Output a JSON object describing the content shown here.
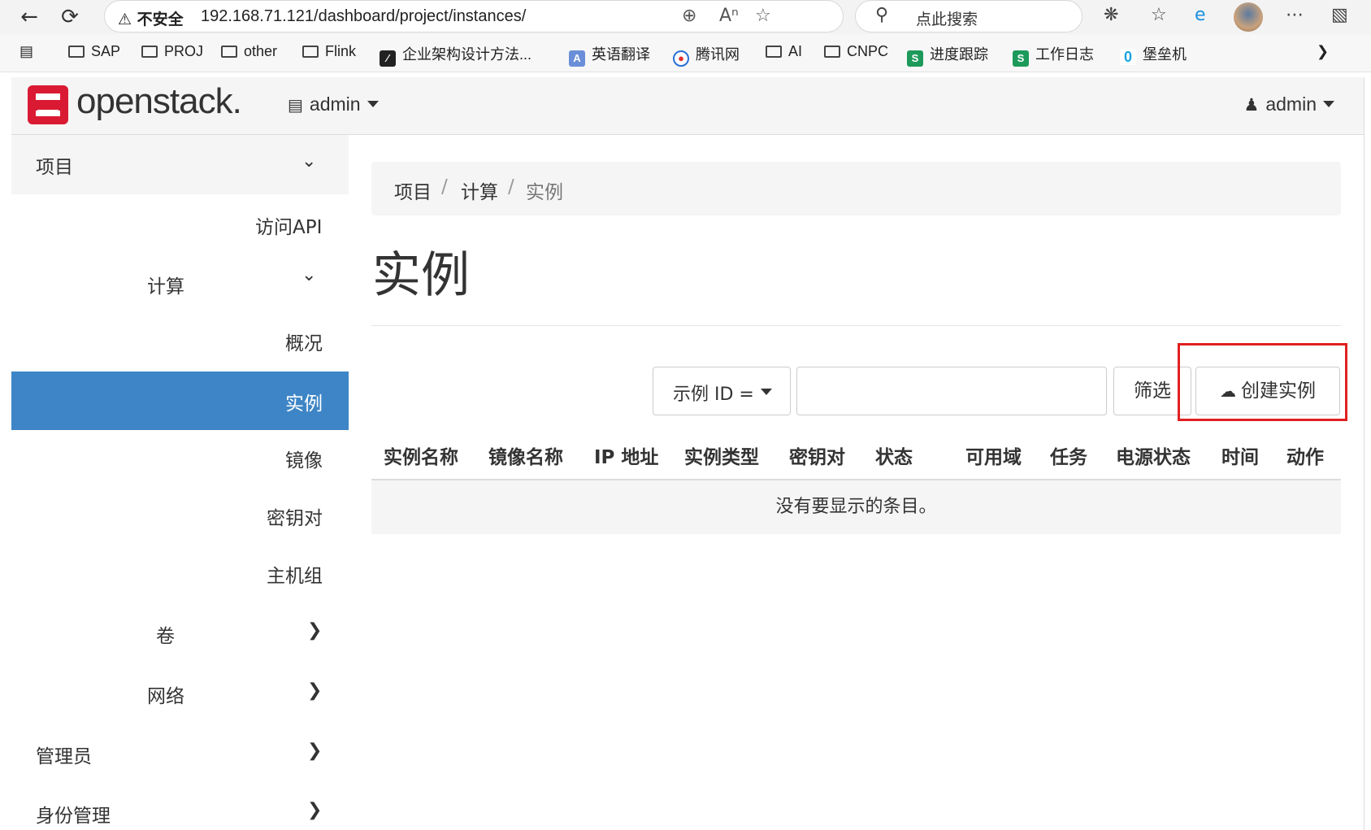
{
  "browser": {
    "security_label": "不安全",
    "url": "192.168.71.121/dashboard/project/instances/",
    "search_text": "点此搜索"
  },
  "bookmarks": [
    {
      "label": "SAP",
      "icon": "folder-icon"
    },
    {
      "label": "PROJ",
      "icon": "folder-icon"
    },
    {
      "label": "other",
      "icon": "folder-icon"
    },
    {
      "label": "Flink",
      "icon": "folder-icon"
    },
    {
      "label": "企业架构设计方法...",
      "icon": "doc-icon"
    },
    {
      "label": "英语翻译",
      "icon": "translate-icon"
    },
    {
      "label": "腾讯网",
      "icon": "tencent-icon"
    },
    {
      "label": "AI",
      "icon": "folder-icon"
    },
    {
      "label": "CNPC",
      "icon": "folder-icon"
    },
    {
      "label": "进度跟踪",
      "icon": "sheet-icon"
    },
    {
      "label": "工作日志",
      "icon": "sheet-icon"
    },
    {
      "label": "堡垒机",
      "icon": "bastion-icon"
    }
  ],
  "header": {
    "logo_text": "openstack.",
    "project_selector": "admin",
    "user_menu": "admin"
  },
  "sidebar": {
    "project": "项目",
    "api_access": "访问API",
    "compute": "计算",
    "overview": "概况",
    "instances": "实例",
    "images": "镜像",
    "key_pairs": "密钥对",
    "server_groups": "主机组",
    "volumes": "卷",
    "network": "网络",
    "admin": "管理员",
    "identity": "身份管理"
  },
  "breadcrumb": [
    "项目",
    "计算",
    "实例"
  ],
  "breadcrumb_sep": "/",
  "page_title": "实例",
  "toolbar": {
    "filter_field": "示例 ID =",
    "filter_button": "筛选",
    "create_button": "创建实例"
  },
  "table": {
    "columns": [
      "实例名称",
      "镜像名称",
      "IP 地址",
      "实例类型",
      "密钥对",
      "状态",
      "可用域",
      "任务",
      "电源状态",
      "时间",
      "动作"
    ],
    "empty_message": "没有要显示的条目。"
  },
  "colors": {
    "active_nav": "#3d85c6",
    "highlight_box": "#e02020",
    "logo_red": "#da1a32"
  }
}
